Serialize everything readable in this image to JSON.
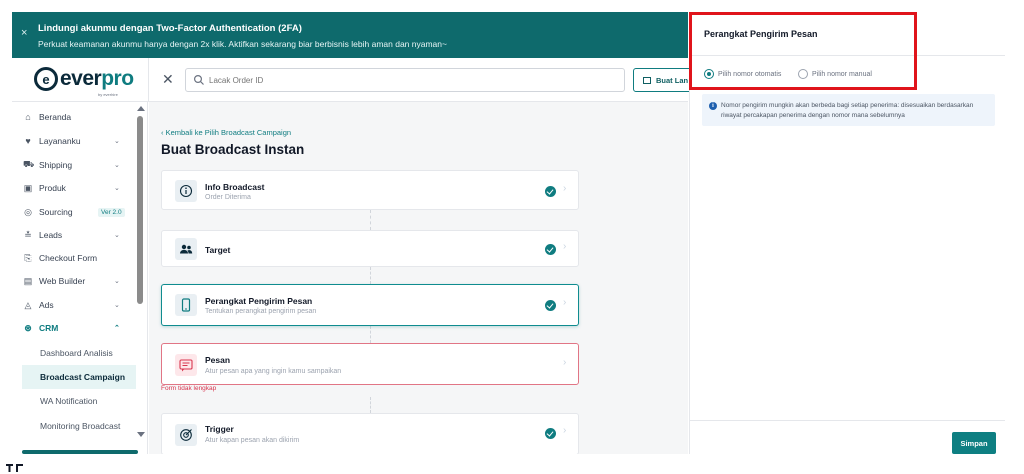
{
  "banner": {
    "title": "Lindungi akunmu dengan Two-Factor Authentication (2FA)",
    "subtitle": "Perkuat keamanan akunmu hanya dengan 2x klik. Aktifkan sekarang biar berbisnis lebih aman dan nyaman~",
    "close_glyph": "×"
  },
  "header": {
    "logo_text_a": "ever",
    "logo_text_b": "pro",
    "logo_mark": "e",
    "logo_by": "by everhire",
    "close_glyph": "✕",
    "search_placeholder": "Lacak Order ID",
    "buat_label": "Buat Lan"
  },
  "sidebar": {
    "items": [
      {
        "label": "Beranda",
        "icon": "⌂"
      },
      {
        "label": "Layananku",
        "icon": "♥"
      },
      {
        "label": "Shipping",
        "icon": "⛟"
      },
      {
        "label": "Produk",
        "icon": "▣"
      },
      {
        "label": "Sourcing",
        "icon": "◎",
        "badge": "Ver 2.0"
      },
      {
        "label": "Leads",
        "icon": "≛"
      },
      {
        "label": "Checkout Form",
        "icon": "⎘"
      },
      {
        "label": "Web Builder",
        "icon": "▤"
      },
      {
        "label": "Ads",
        "icon": "◬"
      },
      {
        "label": "CRM",
        "icon": "⊛"
      }
    ],
    "sub_items": [
      {
        "label": "Dashboard Analisis"
      },
      {
        "label": "Broadcast Campaign"
      },
      {
        "label": "WA Notification"
      },
      {
        "label": "Monitoring Broadcast"
      }
    ],
    "chevron_down": "⌄",
    "chevron_up": "⌃"
  },
  "main": {
    "back_link": "‹ Kembali ke Pilih Broadcast Campaign",
    "title": "Buat Broadcast Instan",
    "steps": [
      {
        "title": "Info Broadcast",
        "subtitle": "Order Diterima",
        "status": "complete",
        "icon": "info-icon"
      },
      {
        "title": "Target",
        "subtitle": "",
        "status": "complete",
        "icon": "users-icon"
      },
      {
        "title": "Perangkat Pengirim Pesan",
        "subtitle": "Tentukan perangkat pengirim pesan",
        "status": "complete",
        "icon": "phone-icon"
      },
      {
        "title": "Pesan",
        "subtitle": "Atur pesan apa yang ingin kamu sampaikan",
        "status": "error",
        "icon": "message-icon"
      },
      {
        "title": "Trigger",
        "subtitle": "Atur kapan pesan akan dikirim",
        "status": "complete",
        "icon": "target-icon"
      }
    ],
    "error_text": "Form tidak lengkap",
    "arrow_glyph": "›"
  },
  "panel": {
    "title": "Perangkat Pengirim Pesan",
    "options": [
      {
        "label": "Pilih nomor otomatis",
        "selected": true
      },
      {
        "label": "Pilih nomor manual",
        "selected": false
      }
    ],
    "info_icon": "i",
    "info_text": "Nomor pengirim mungkin akan berbeda bagi setiap penerima: disesuaikan berdasarkan riwayat percakapan penerima dengan nomor mana sebelumnya",
    "save_label": "Simpan"
  },
  "colors": {
    "brand": "#0e6a6c",
    "accent": "#0f7c80",
    "error": "#d9364f",
    "highlight": "#e0141b"
  }
}
